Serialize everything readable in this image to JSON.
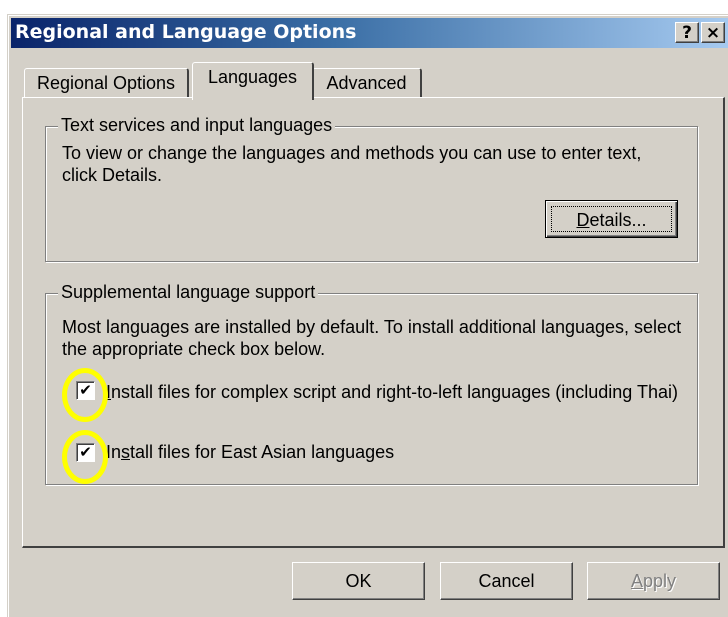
{
  "window": {
    "title": "Regional and Language Options",
    "help_button": "?",
    "close_button": "×"
  },
  "tabs": [
    {
      "label": "Regional Options",
      "selected": false
    },
    {
      "label": "Languages",
      "selected": true
    },
    {
      "label": "Advanced",
      "selected": false
    }
  ],
  "text_services": {
    "legend": "Text services and input languages",
    "description": "To view or change the languages and methods you can use to enter text, click Details.",
    "details_button_accel": "D",
    "details_button_rest": "etails..."
  },
  "supplemental": {
    "legend": "Supplemental language support",
    "description": "Most languages are installed by default. To install additional languages, select the appropriate check box below.",
    "checkbox_complex": {
      "checked": true,
      "check_glyph": "✔",
      "accel": "I",
      "label_rest": "nstall files for complex script and right-to-left languages (including Thai)"
    },
    "checkbox_east_asian": {
      "checked": true,
      "check_glyph": "✔",
      "label_before": "In",
      "accel": "s",
      "label_rest": "tall files for East Asian languages"
    }
  },
  "footer": {
    "ok": "OK",
    "cancel": "Cancel",
    "apply_accel": "A",
    "apply_rest": "pply"
  },
  "colors": {
    "dialog_face": "#d4d0c8",
    "title_gradient_start": "#0a246a",
    "title_gradient_end": "#a6caf0",
    "highlight": "#ffff00"
  }
}
